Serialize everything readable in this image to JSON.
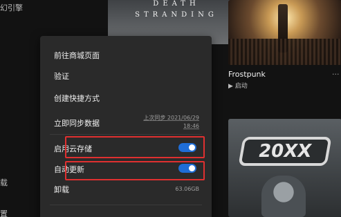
{
  "sidebar": {
    "items": [
      {
        "label": "幻引擎"
      },
      {
        "label": "载"
      },
      {
        "label": "置"
      }
    ]
  },
  "games": {
    "death_stranding": {
      "title_line1": "DEATH",
      "title_line2": "STRANDING"
    },
    "frostpunk": {
      "name": "Frostpunk",
      "action": "▶ 启动",
      "more": "···"
    },
    "twentyxx": {
      "logo": "20XX"
    }
  },
  "context_menu": {
    "items": {
      "store_page": "前往商城页面",
      "verify": "验证",
      "shortcut": "创建快捷方式",
      "sync": "立即同步数据",
      "cloud_save": "启用云存储",
      "auto_update": "自动更新",
      "uninstall": "卸载"
    },
    "last_sync": "上次同步 2021/06/29 18:46",
    "install_size": "63.06GB",
    "cloud_save_enabled": true,
    "auto_update_enabled": true
  },
  "colors": {
    "toggle_on": "#1f6dd6",
    "highlight": "#e03030",
    "menu_bg": "#2a2a2a"
  }
}
